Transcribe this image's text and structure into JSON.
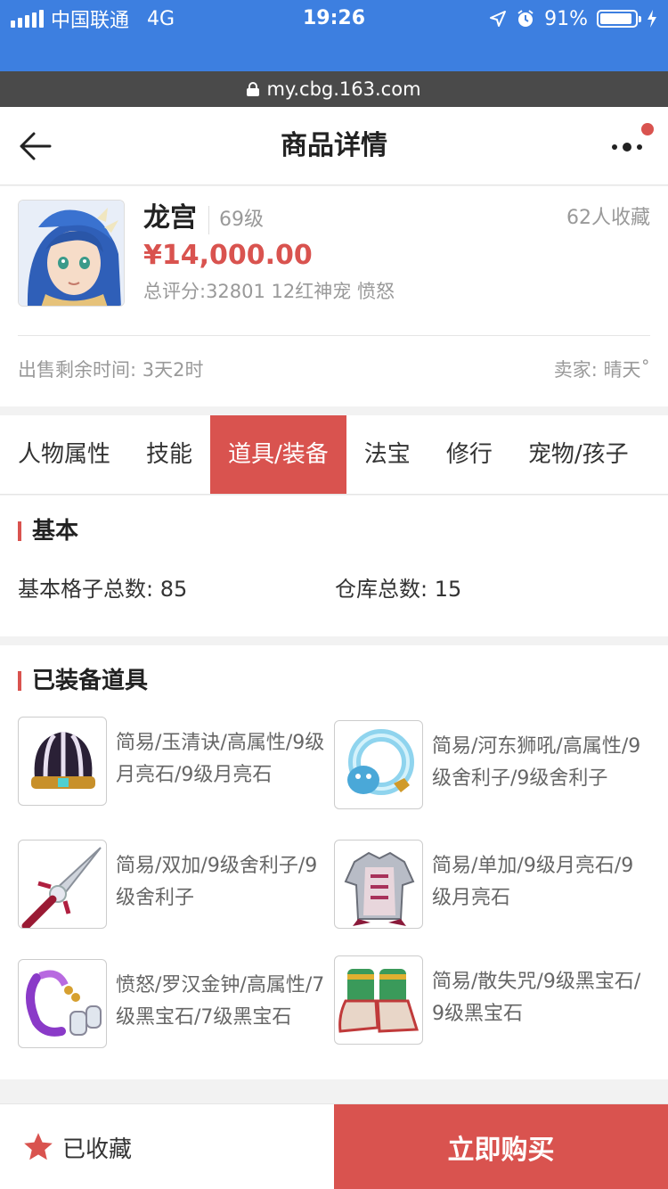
{
  "status_bar": {
    "carrier": "中国联通",
    "network": "4G",
    "time": "19:26",
    "battery": "91%",
    "battery_level": 0.91
  },
  "url_bar": {
    "url": "my.cbg.163.com"
  },
  "nav": {
    "title": "商品详情"
  },
  "product": {
    "name": "龙宫",
    "level": "69级",
    "favorites": "62人收藏",
    "price": "¥14,000.00",
    "info": "总评分:32801 12红神宠 愤怒",
    "remaining_time": "出售剩余时间: 3天2时",
    "seller": "卖家: 晴天˚"
  },
  "tabs": [
    {
      "label": "人物属性"
    },
    {
      "label": "技能"
    },
    {
      "label": "道具/装备",
      "active": true
    },
    {
      "label": "法宝"
    },
    {
      "label": "修行"
    },
    {
      "label": "宠物/孩子"
    }
  ],
  "basic": {
    "title": "基本",
    "grid_label": "基本格子总数:",
    "grid_value": "85",
    "warehouse_label": "仓库总数:",
    "warehouse_value": "15"
  },
  "equipment": {
    "title": "已装备道具",
    "items": [
      {
        "icon": "helmet-icon",
        "text": "简易/玉清诀/高属性/9级月亮石/9级月亮石"
      },
      {
        "icon": "necklace-icon",
        "text": "简易/河东狮吼/高属性/9级舍利子/9级舍利子"
      },
      {
        "icon": "sword-icon",
        "text": "简易/双加/9级舍利子/9级舍利子"
      },
      {
        "icon": "armor-icon",
        "text": "简易/单加/9级月亮石/9级月亮石"
      },
      {
        "icon": "belt-icon",
        "text": "愤怒/罗汉金钟/高属性/7级黑宝石/7级黑宝石"
      },
      {
        "icon": "boots-icon",
        "text": "简易/散失咒/9级黑宝石/9级黑宝石"
      }
    ]
  },
  "bottom": {
    "favorite_label": "已收藏",
    "buy_label": "立即购买"
  },
  "colors": {
    "status_bar": "#3d7fe0",
    "url_bar": "#4a4a4a",
    "accent": "#d9534f",
    "star": "#d9534f"
  }
}
